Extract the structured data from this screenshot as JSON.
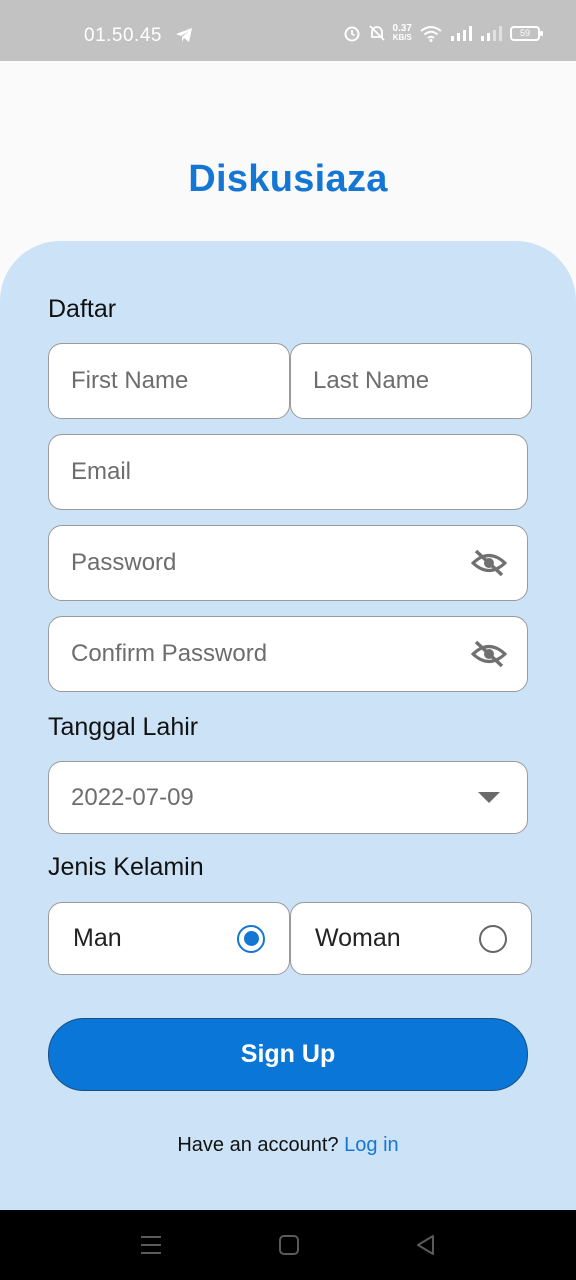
{
  "status_bar": {
    "time": "01.50.45",
    "net_speed": "0.37",
    "net_unit": "KB/S",
    "battery": "59"
  },
  "app": {
    "title": "Diskusiaza",
    "brand_color": "#1577d4"
  },
  "form": {
    "heading": "Daftar",
    "first_name_placeholder": "First Name",
    "last_name_placeholder": "Last Name",
    "email_placeholder": "Email",
    "password_placeholder": "Password",
    "confirm_password_placeholder": "Confirm Password",
    "birth_label": "Tanggal Lahir",
    "birth_value": "2022-07-09",
    "gender_label": "Jenis Kelamin",
    "gender_options": [
      {
        "label": "Man",
        "selected": true
      },
      {
        "label": "Woman",
        "selected": false
      }
    ],
    "submit_label": "Sign Up"
  },
  "footer": {
    "prompt": "Have an account?",
    "login_label": "Log in"
  },
  "icons": {
    "password_toggle": "eye-off-icon",
    "dropdown": "chevron-down-icon"
  }
}
